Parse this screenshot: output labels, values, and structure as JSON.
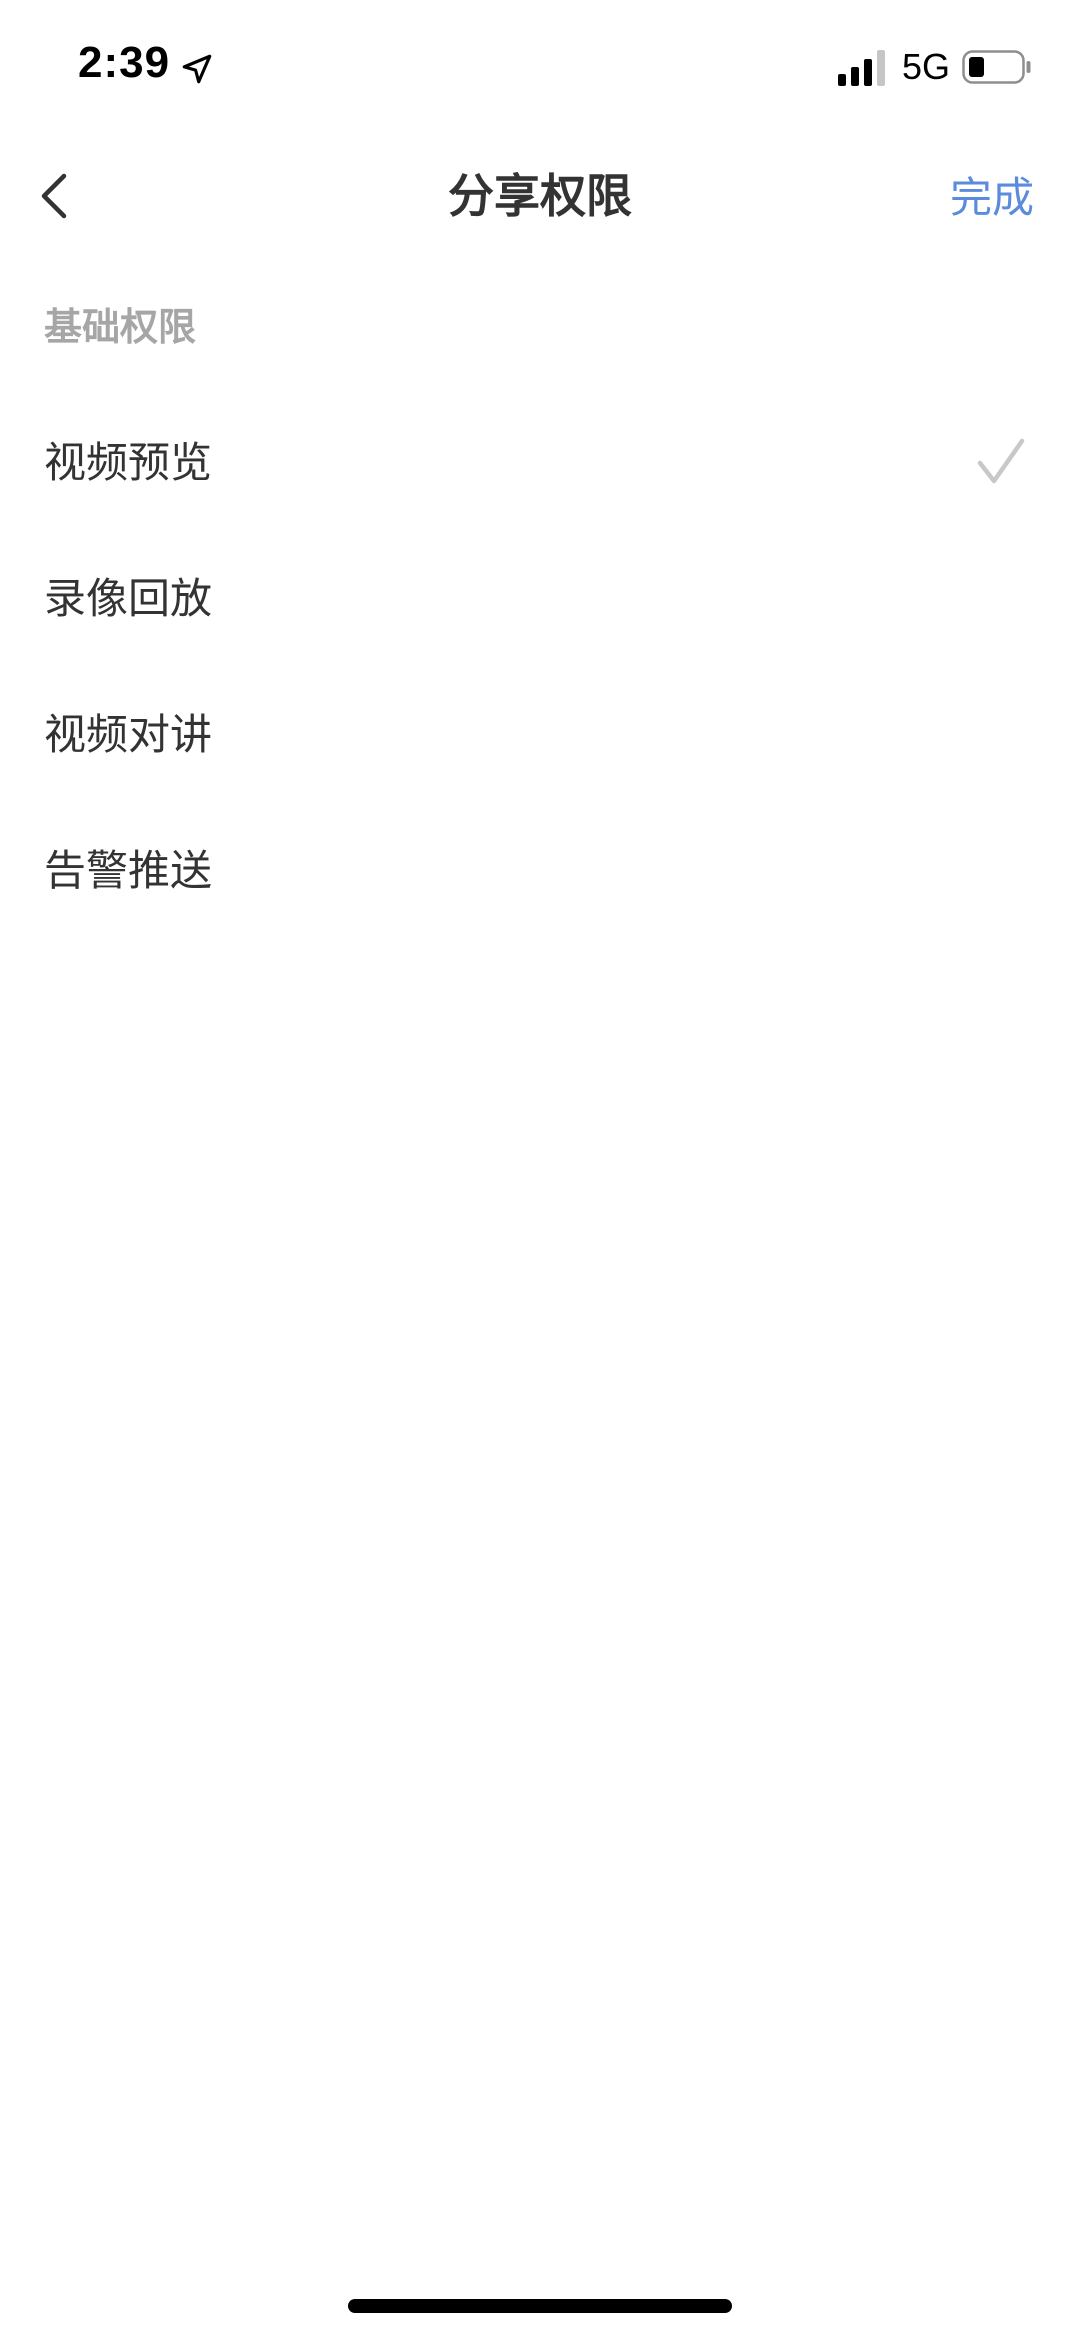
{
  "status_bar": {
    "time": "2:39",
    "network": "5G",
    "icons": {
      "location": "location-arrow-icon",
      "signal": "cellular-signal-icon",
      "battery": "battery-icon"
    }
  },
  "nav": {
    "back_icon": "chevron-left-icon",
    "title": "分享权限",
    "done_label": "完成",
    "done_color": "#5b8bdc"
  },
  "section": {
    "title": "基础权限",
    "title_color": "#a6a6a6"
  },
  "permissions": [
    {
      "label": "视频预览",
      "checked": true
    },
    {
      "label": "录像回放",
      "checked": false
    },
    {
      "label": "视频对讲",
      "checked": false
    },
    {
      "label": "告警推送",
      "checked": false
    }
  ],
  "check_icon": "checkmark-icon",
  "check_color": "#c8c8c8"
}
